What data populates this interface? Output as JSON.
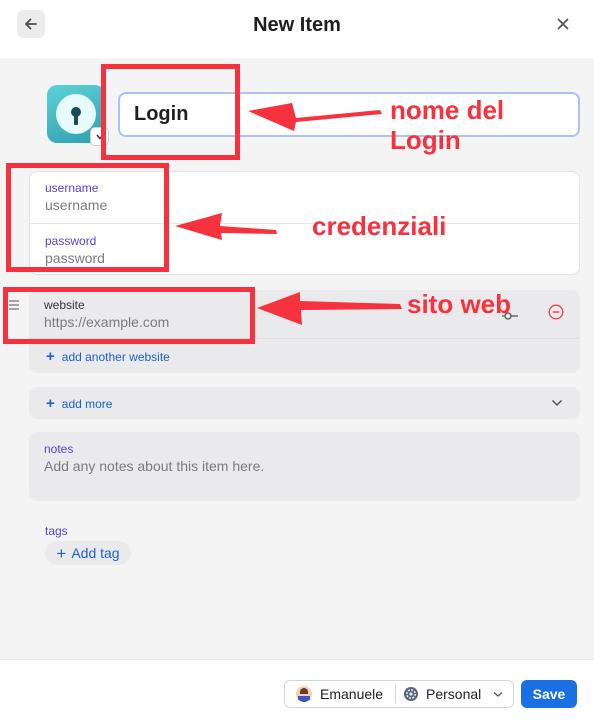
{
  "header": {
    "title": "New Item",
    "back_icon": "arrow-left-icon",
    "close_icon": "close-icon"
  },
  "item": {
    "name": "Login",
    "icon": "keyhole-icon"
  },
  "credentials": {
    "username_label": "username",
    "username_placeholder": "username",
    "password_label": "password",
    "password_placeholder": "password"
  },
  "website": {
    "label": "website",
    "placeholder": "https://example.com",
    "add_another_label": "add another website"
  },
  "more": {
    "label": "add more"
  },
  "notes": {
    "label": "notes",
    "placeholder": "Add any notes about this item here."
  },
  "tags": {
    "label": "tags",
    "add_label": "Add tag"
  },
  "footer": {
    "user": "Emanuele",
    "vault": "Personal",
    "save_label": "Save"
  },
  "annotations": {
    "name": "nome del Login",
    "credentials": "credenziali",
    "website": "sito web",
    "color": "#f5323e"
  }
}
